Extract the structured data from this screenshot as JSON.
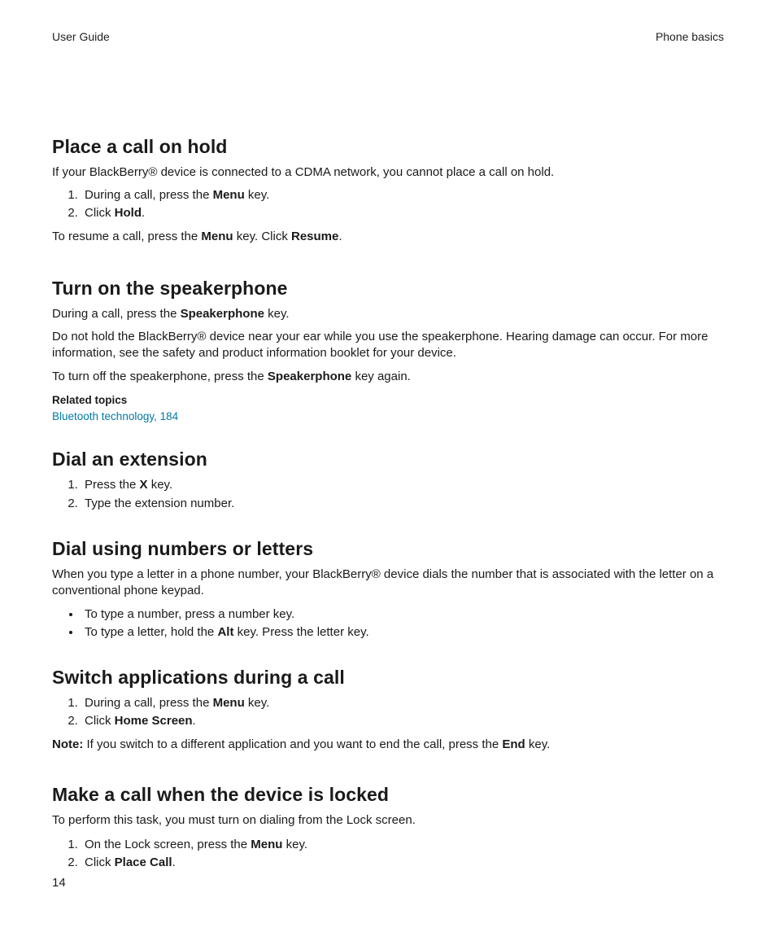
{
  "header": {
    "left": "User Guide",
    "right": "Phone basics"
  },
  "sections": {
    "s1": {
      "title": "Place a call on hold",
      "intro": "If your BlackBerry® device is connected to a CDMA network, you cannot place a call on hold.",
      "step1_pre": "During a call, press the ",
      "step1_bold": "Menu",
      "step1_post": " key.",
      "step2_pre": "Click ",
      "step2_bold": "Hold",
      "step2_post": ".",
      "resume_a": "To resume a call, press the ",
      "resume_b": "Menu",
      "resume_c": " key. Click ",
      "resume_d": "Resume",
      "resume_e": "."
    },
    "s2": {
      "title": "Turn on the speakerphone",
      "p1_a": "During a call, press the ",
      "p1_b": "Speakerphone",
      "p1_c": " key.",
      "p2": "Do not hold the BlackBerry® device near your ear while you use the speakerphone. Hearing damage can occur. For more information, see the safety and product information booklet for your device.",
      "p3_a": "To turn off the speakerphone, press the ",
      "p3_b": "Speakerphone",
      "p3_c": " key again.",
      "related_title": "Related topics",
      "related_link": "Bluetooth technology, 184"
    },
    "s3": {
      "title": "Dial an extension",
      "step1_a": "Press the ",
      "step1_b": "X",
      "step1_c": " key.",
      "step2": "Type the extension number."
    },
    "s4": {
      "title": "Dial using numbers or letters",
      "intro": "When you type a letter in a phone number, your BlackBerry® device dials the number that is associated with the letter on a conventional phone keypad.",
      "b1": "To type a number, press a number key.",
      "b2_a": "To type a letter, hold the ",
      "b2_b": "Alt",
      "b2_c": " key. Press the letter key."
    },
    "s5": {
      "title": "Switch applications during a call",
      "step1_a": "During a call, press the ",
      "step1_b": "Menu",
      "step1_c": " key.",
      "step2_a": "Click ",
      "step2_b": "Home Screen",
      "step2_c": ".",
      "note_label": "Note:",
      "note_a": "  If you switch to a different application and you want to end the call, press the ",
      "note_b": "End",
      "note_c": " key."
    },
    "s6": {
      "title": "Make a call when the device is locked",
      "intro": "To perform this task, you must turn on dialing from the Lock screen.",
      "step1_a": "On the Lock screen, press the ",
      "step1_b": "Menu",
      "step1_c": " key.",
      "step2_a": "Click ",
      "step2_b": "Place Call",
      "step2_c": "."
    }
  },
  "page_number": "14"
}
